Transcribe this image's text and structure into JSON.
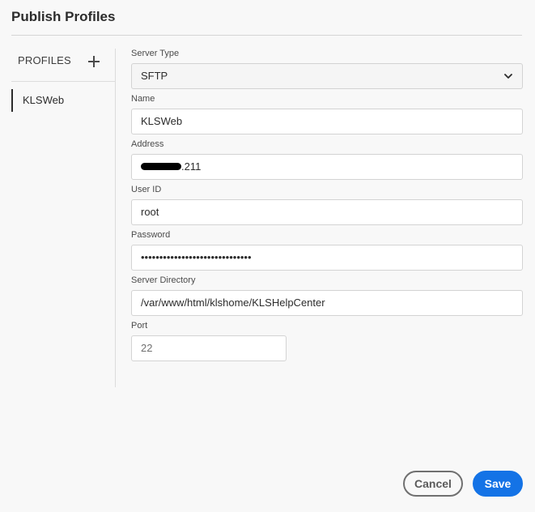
{
  "dialog": {
    "title": "Publish Profiles"
  },
  "sidebar": {
    "header": "PROFILES",
    "add_icon": "plus-icon",
    "items": [
      {
        "label": "KLSWeb",
        "selected": true
      }
    ]
  },
  "form": {
    "server_type": {
      "label": "Server Type",
      "value": "SFTP",
      "icon": "chevron-down-icon"
    },
    "name": {
      "label": "Name",
      "value": "KLSWeb"
    },
    "address": {
      "label": "Address",
      "value_suffix": ".211"
    },
    "user_id": {
      "label": "User ID",
      "value": "root"
    },
    "password": {
      "label": "Password",
      "value": "••••••••••••••••••••••••••••••"
    },
    "server_directory": {
      "label": "Server Directory",
      "value": "/var/www/html/klshome/KLSHelpCenter"
    },
    "port": {
      "label": "Port",
      "value": "22"
    }
  },
  "buttons": {
    "cancel": "Cancel",
    "save": "Save"
  },
  "colors": {
    "accent": "#1473e6",
    "background": "#f8f8f8"
  }
}
